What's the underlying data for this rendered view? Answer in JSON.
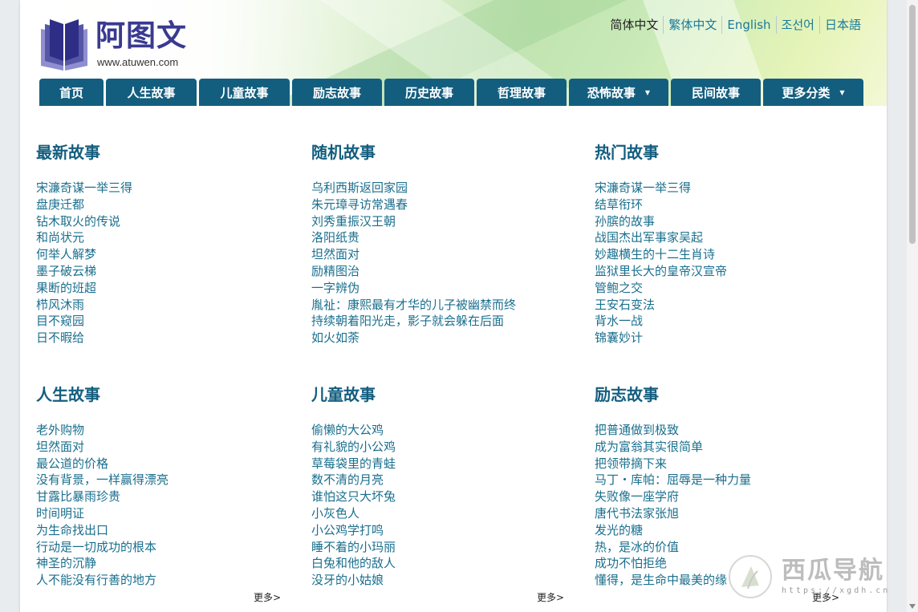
{
  "site": {
    "name": "阿图文",
    "url": "www.atuwen.com"
  },
  "languages": [
    {
      "label": "简体中文",
      "active": true
    },
    {
      "label": "繁体中文",
      "active": false
    },
    {
      "label": "English",
      "active": false
    },
    {
      "label": "조선어",
      "active": false
    },
    {
      "label": "日本語",
      "active": false
    }
  ],
  "nav": [
    {
      "label": "首页",
      "has_dropdown": false
    },
    {
      "label": "人生故事",
      "has_dropdown": false
    },
    {
      "label": "儿童故事",
      "has_dropdown": false
    },
    {
      "label": "励志故事",
      "has_dropdown": false
    },
    {
      "label": "历史故事",
      "has_dropdown": false
    },
    {
      "label": "哲理故事",
      "has_dropdown": false
    },
    {
      "label": "恐怖故事",
      "has_dropdown": true
    },
    {
      "label": "民间故事",
      "has_dropdown": false
    },
    {
      "label": "更多分类",
      "has_dropdown": true
    }
  ],
  "sections": [
    {
      "title": "最新故事",
      "items": [
        "宋濂奇谋一举三得",
        "盘庚迁都",
        "钻木取火的传说",
        "和尚状元",
        "何举人解梦",
        "墨子破云梯",
        "果断的班超",
        "栉风沐雨",
        "目不窥园",
        "日不暇给"
      ]
    },
    {
      "title": "随机故事",
      "items": [
        "乌利西斯返回家园",
        "朱元璋寻访常遇春",
        "刘秀重振汉王朝",
        "洛阳纸贵",
        "坦然面对",
        "励精图治",
        "一字辨伪",
        "胤祉：康熙最有才华的儿子被幽禁而终",
        "持续朝着阳光走，影子就会躲在后面",
        "如火如荼"
      ]
    },
    {
      "title": "热门故事",
      "items": [
        "宋濂奇谋一举三得",
        "结草衔环",
        "孙膑的故事",
        "战国杰出军事家吴起",
        "妙趣横生的十二生肖诗",
        "监狱里长大的皇帝汉宣帝",
        "管鲍之交",
        "王安石变法",
        "背水一战",
        "锦囊妙计"
      ]
    },
    {
      "title": "人生故事",
      "items": [
        "老外购物",
        "坦然面对",
        "最公道的价格",
        "没有背景，一样赢得漂亮",
        "甘露比暴雨珍贵",
        "时间明证",
        "为生命找出口",
        "行动是一切成功的根本",
        "神圣的沉静",
        "人不能没有行善的地方"
      ],
      "more": "更多>"
    },
    {
      "title": "儿童故事",
      "items": [
        "偷懒的大公鸡",
        "有礼貌的小公鸡",
        "草莓袋里的青蛙",
        "数不清的月亮",
        "谁怕这只大坏兔",
        "小灰色人",
        "小公鸡学打鸣",
        "睡不着的小玛丽",
        "白兔和他的敌人",
        "没牙的小姑娘"
      ],
      "more": "更多>"
    },
    {
      "title": "励志故事",
      "items": [
        "把普通做到极致",
        "成为富翁其实很简单",
        "把领带摘下来",
        "马丁・库帕：屈辱是一种力量",
        "失败像一座学府",
        "唐代书法家张旭",
        "发光的糖",
        "热，是冰的价值",
        "成功不怕拒绝",
        "懂得，是生命中最美的缘"
      ],
      "more": "更多>"
    }
  ],
  "watermark": {
    "name": "西瓜导航",
    "url": "https://xgdh.cn"
  },
  "colors": {
    "nav_bg": "#135e7f",
    "heading": "#135e7f",
    "link": "#1a6f8e",
    "logo": "#3a3a90"
  }
}
